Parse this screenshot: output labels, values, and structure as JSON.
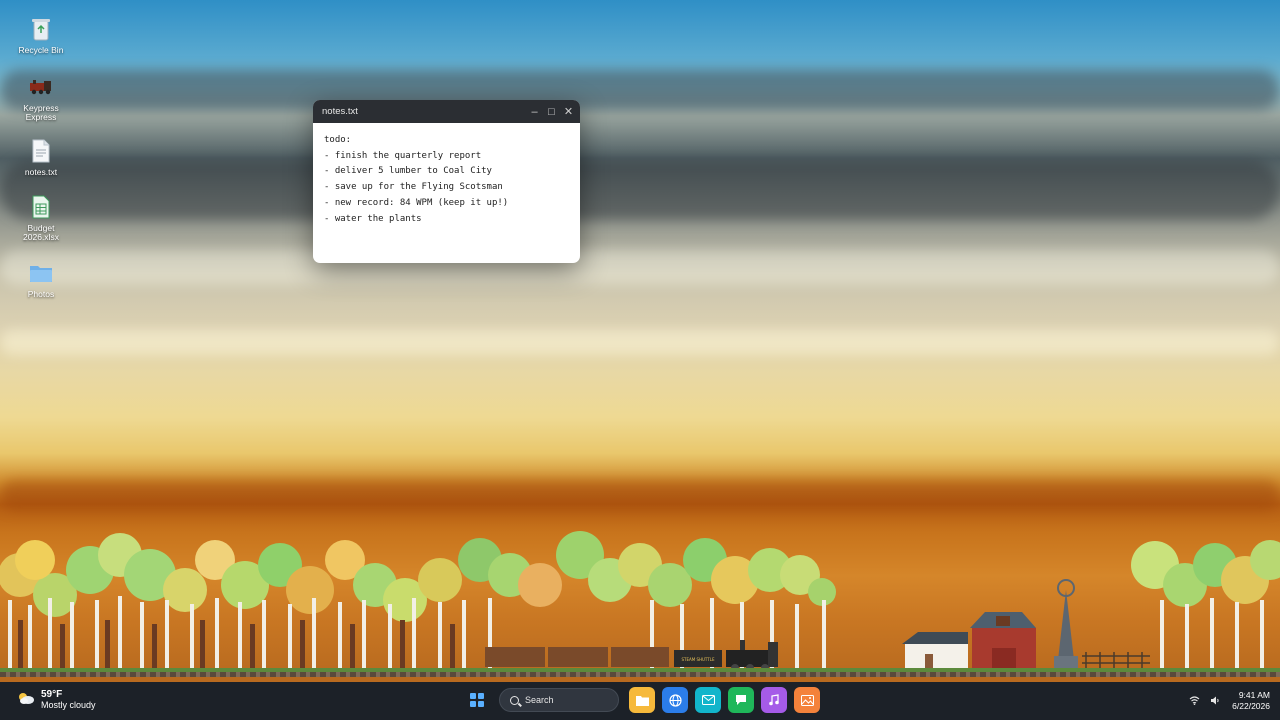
{
  "desktop": {
    "icons": [
      {
        "label": "Recycle Bin",
        "icon": "recycle-bin-icon"
      },
      {
        "label": "Keypress Express",
        "icon": "train-game-icon"
      },
      {
        "label": "notes.txt",
        "icon": "text-file-icon"
      },
      {
        "label": "Budget 2026.xlsx",
        "icon": "spreadsheet-icon"
      },
      {
        "label": "Photos",
        "icon": "folder-icon"
      }
    ]
  },
  "window": {
    "title": "notes.txt",
    "lines": [
      "todo:",
      "- finish the quarterly report",
      "- deliver 5 lumber to Coal City",
      "- save up for the Flying Scotsman",
      "- new record: 84 WPM (keep it up!)",
      "- water the plants"
    ]
  },
  "taskbar": {
    "weather": {
      "temp": "59°F",
      "condition": "Mostly cloudy",
      "icon": "cloudy-sun-icon"
    },
    "search_label": "Search",
    "apps": [
      {
        "name": "file-explorer",
        "color": "#f6b93b"
      },
      {
        "name": "browser",
        "color": "#2b7de9"
      },
      {
        "name": "mail",
        "color": "#12b5cb"
      },
      {
        "name": "messages",
        "color": "#1fb75a"
      },
      {
        "name": "music",
        "color": "#a55be8"
      },
      {
        "name": "photos",
        "color": "#f4823b"
      }
    ],
    "time": "9:41 AM",
    "date": "6/22/2026"
  },
  "scene": {
    "train_sign": "STEAM SHUTTLE"
  }
}
